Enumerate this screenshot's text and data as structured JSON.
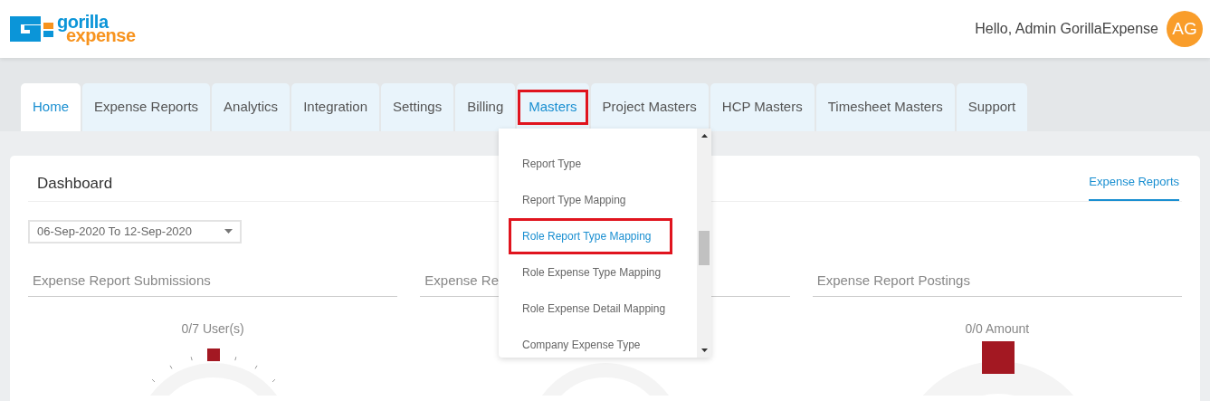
{
  "header": {
    "logo_top": "gorilla",
    "logo_bottom": "expense",
    "greeting": "Hello, Admin GorillaExpense",
    "avatar": "AG"
  },
  "tabs": [
    {
      "label": "Home",
      "selected": true,
      "highlighted": false
    },
    {
      "label": "Expense Reports",
      "selected": false,
      "highlighted": false
    },
    {
      "label": "Analytics",
      "selected": false,
      "highlighted": false
    },
    {
      "label": "Integration",
      "selected": false,
      "highlighted": false
    },
    {
      "label": "Settings",
      "selected": false,
      "highlighted": false
    },
    {
      "label": "Billing",
      "selected": false,
      "highlighted": false
    },
    {
      "label": "Masters",
      "selected": false,
      "highlighted": true
    },
    {
      "label": "Project Masters",
      "selected": false,
      "highlighted": false
    },
    {
      "label": "HCP Masters",
      "selected": false,
      "highlighted": false
    },
    {
      "label": "Timesheet Masters",
      "selected": false,
      "highlighted": false
    },
    {
      "label": "Support",
      "selected": false,
      "highlighted": false
    }
  ],
  "masters_menu": [
    {
      "label": "Report Type",
      "selected": false,
      "highlighted": false
    },
    {
      "label": "Report Type Mapping",
      "selected": false,
      "highlighted": false
    },
    {
      "label": "Role Report Type Mapping",
      "selected": true,
      "highlighted": true
    },
    {
      "label": "Role Expense Type Mapping",
      "selected": false,
      "highlighted": false
    },
    {
      "label": "Role Expense Detail Mapping",
      "selected": false,
      "highlighted": false
    },
    {
      "label": "Company Expense Type",
      "selected": false,
      "highlighted": false
    }
  ],
  "dashboard": {
    "title": "Dashboard",
    "link": "Expense Reports",
    "date_range": "06-Sep-2020 To 12-Sep-2020",
    "panels": [
      {
        "title": "Expense Report Submissions",
        "reading": "0/7 User(s)",
        "kind": "ticks"
      },
      {
        "title": "Expense Re",
        "kind": "plain"
      },
      {
        "title": "Expense Report Postings",
        "reading": "0/0 Amount",
        "kind": "block"
      }
    ]
  }
}
